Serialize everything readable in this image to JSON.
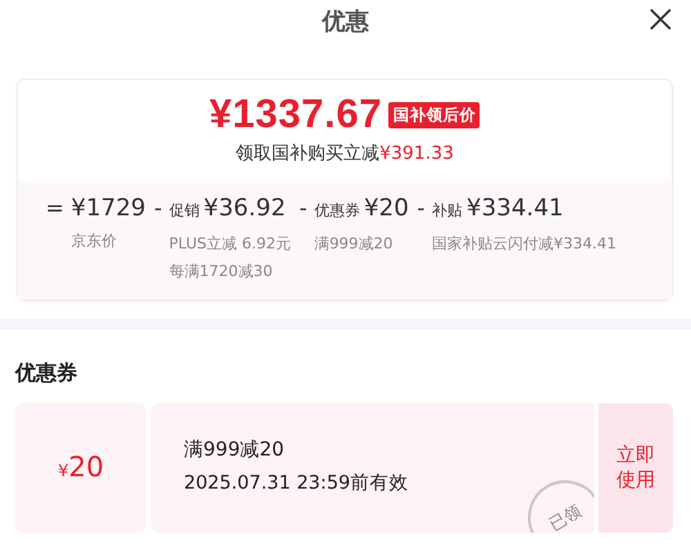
{
  "header": {
    "title": "优惠"
  },
  "price": {
    "amount": "¥1337.67",
    "badge": "国补领后价",
    "subtitle": "领取国补购买立减",
    "saving": "¥391.33"
  },
  "breakdown": [
    {
      "op": "=",
      "amount": "¥1729",
      "notes": [
        "京东价"
      ]
    },
    {
      "op": "-",
      "label": "促销",
      "amount": "¥36.92",
      "notes": [
        "PLUS立减 6.92元",
        "每满1720减30"
      ]
    },
    {
      "op": "-",
      "label": "优惠券",
      "amount": "¥20",
      "notes": [
        "满999减20"
      ]
    },
    {
      "op": "-",
      "label": "补贴",
      "amount": "¥334.41",
      "notes": [
        "国家补贴云闪付减¥334.41"
      ]
    }
  ],
  "coupons_section": {
    "title": "优惠券"
  },
  "coupons": [
    {
      "currency": "¥",
      "amount": "20",
      "title": "满999减20",
      "validity": "2025.07.31 23:59前有效",
      "action": "立即使用",
      "claimed": true,
      "stamp": "已领"
    }
  ]
}
